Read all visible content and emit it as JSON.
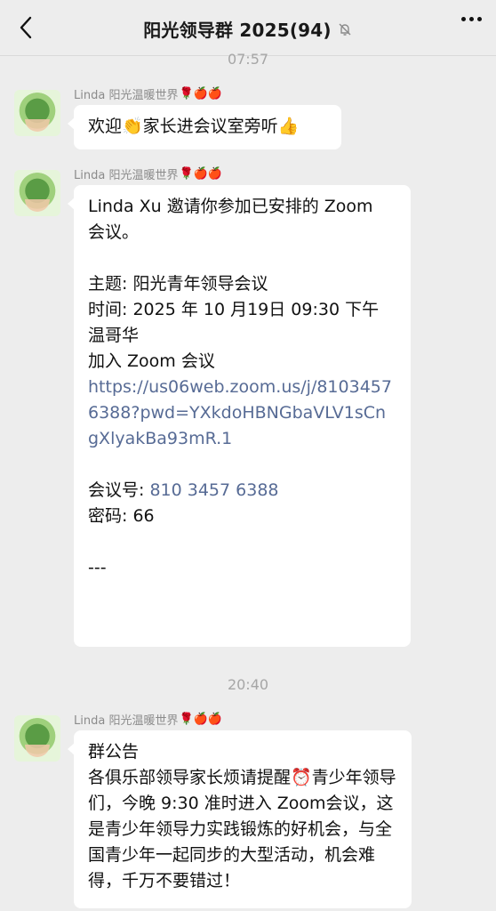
{
  "header": {
    "back_icon": "chevron-left-icon",
    "title": "阳光领导群 2025(94)",
    "mute_icon": "bell-slash-icon",
    "more_icon": "more-dots-icon"
  },
  "messages": [
    {
      "time": "07:57",
      "sender": "Linda 阳光温暖世界",
      "sender_emojis": "🌹🍎🍎",
      "text": "欢迎👏家长进会议室旁听👍"
    },
    {
      "sender": "Linda 阳光温暖世界",
      "sender_emojis": "🌹🍎🍎",
      "invite_line1": "Linda Xu 邀请你参加已安排的 Zoom",
      "invite_line2": "会议。",
      "topic": "主题: 阳光青年领导会议",
      "time_line1": "时间: 2025 年 10 月19日 09:30 下午",
      "time_line2": "温哥华",
      "join_label": "加入 Zoom 会议",
      "join_link": "https://us06web.zoom.us/j/81034576388?pwd=YXkdoHBNGbaVLV1sCngXlyakBa93mR.1",
      "meeting_id_label": "会议号: ",
      "meeting_id": "810 3457 6388",
      "password": "密码: 66",
      "separator": "---"
    },
    {
      "time": "20:40",
      "sender": "Linda 阳光温暖世界",
      "sender_emojis": "🌹🍎🍎",
      "title": "群公告",
      "body": "各俱乐部领导家长烦请提醒⏰青少年领导们，今晚 9:30 准时进入 Zoom会议，这是青少年领导力实践锻炼的好机会，与全国青少年一起同步的大型活动，机会难得，千万不要错过！"
    }
  ]
}
